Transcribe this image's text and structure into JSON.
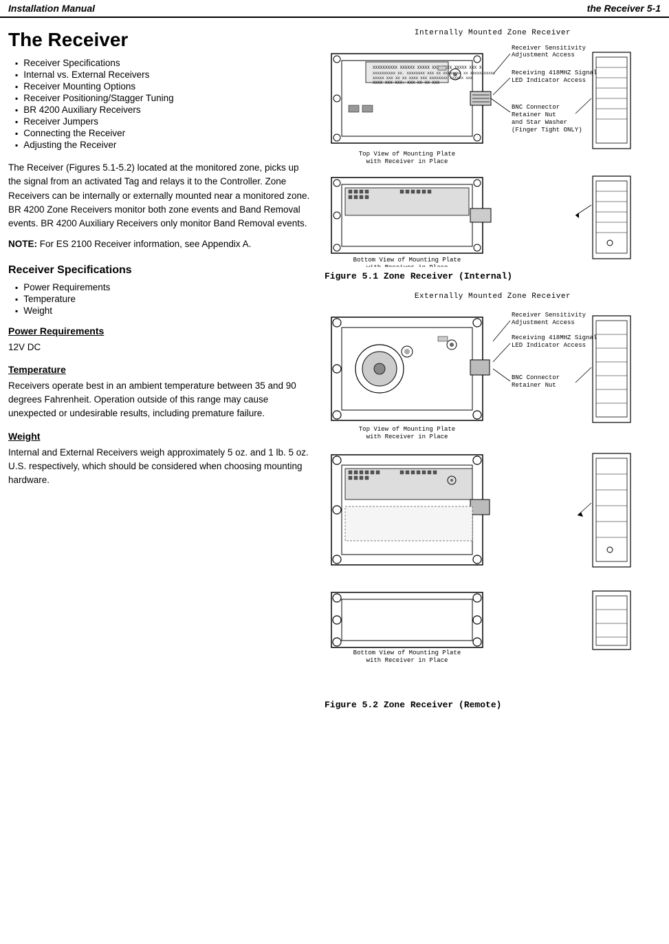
{
  "header": {
    "left": "Installation Manual",
    "right": "the Receiver 5-1"
  },
  "main_title": "The Receiver",
  "toc": {
    "items": [
      "Receiver Specifications",
      "Internal vs. External Receivers",
      "Receiver Mounting Options",
      "Receiver Positioning/Stagger Tuning",
      "BR 4200 Auxiliary Receivers",
      "Receiver Jumpers",
      "Connecting the Receiver",
      "Adjusting the Receiver"
    ]
  },
  "intro_text": "The Receiver (Figures 5.1-5.2) located at the monitored zone, picks up the signal from an activated Tag and relays it to the Controller. Zone Receivers can be internally or externally mounted near a monitored zone. BR 4200 Zone Receivers monitor both zone events and Band Removal events. BR 4200 Auxiliary Receivers only monitor Band Removal events.",
  "note_text": "NOTE: For ES 2100 Receiver information, see Appendix A.",
  "sections": {
    "specs_heading": "Receiver Specifications",
    "specs_list": [
      "Power Requirements",
      "Temperature",
      "Weight"
    ],
    "power_heading": "Power Requirements",
    "power_value": "12V DC",
    "temp_heading": "Temperature",
    "temp_text": "Receivers operate best in an ambient temperature between 35 and 90 degrees Fahrenheit. Operation outside of this range may cause unexpected or undesirable results, including premature failure.",
    "weight_heading": "Weight",
    "weight_text": "Internal and External Receivers weigh approximately 5 oz. and 1 lb. 5 oz. U.S. respectively, which should be considered when choosing mounting hardware."
  },
  "figures": {
    "fig1": {
      "title_line1": "Internally Mounted Zone Receiver",
      "top_view_label": "Top View of Mounting Plate",
      "top_view_sub": "with Receiver in Place",
      "bottom_view_label": "Bottom View of Mounting Plate",
      "bottom_view_sub": "with Receiver in Place",
      "caption": "Figure 5.1 Zone Receiver (Internal)",
      "annotations": [
        "Receiver Sensitivity",
        "Adjustment Access",
        "Receiving 418MHZ Signal",
        "LED Indicator Access",
        "BNC Connector",
        "Retainer Nut",
        "and Star Washer",
        "(Finger Tight ONLY)"
      ]
    },
    "fig2": {
      "title_line1": "Externally Mounted Zone Receiver",
      "top_view_label": "Top View of Mounting Plate",
      "top_view_sub": "with Receiver in Place",
      "bottom_view_label": "Bottom View of Mounting Plate",
      "bottom_view_sub": "with Receiver in Place",
      "caption": "Figure 5.2 Zone Receiver (Remote)",
      "annotations": [
        "Receiver Sensitivity",
        "Adjustment Access",
        "Receiving 418MHZ Signal",
        "LED Indicator Access",
        "BNC Connector",
        "Retainer Nut"
      ]
    }
  }
}
